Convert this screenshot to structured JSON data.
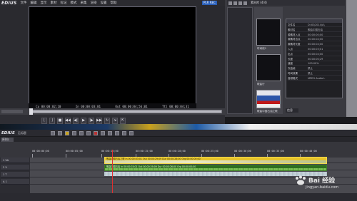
{
  "app": {
    "name": "EDIUS",
    "mode_badge": "PLR REC"
  },
  "menu": [
    "文件",
    "编辑",
    "显示",
    "素材",
    "标记",
    "模式",
    "采集",
    "渲染",
    "设置",
    "帮助"
  ],
  "player": {
    "cue": "Cu 00:00:02;10",
    "in": "In 00:00:03;01",
    "out": "Out 00:00:04;56;01",
    "dur": "Ttl 00:00:04;31"
  },
  "bin": {
    "title": "素材库 (4/4)",
    "thumbs": [
      {
        "label": "时间线1"
      },
      {
        "label": "歌曲行"
      },
      {
        "label": "歌曲中国石油之歌"
      }
    ]
  },
  "properties": {
    "rows": [
      {
        "k": "文件名",
        "v": "D:\\ID\\2014\\A\\"
      },
      {
        "k": "素材名",
        "v": "歌曲中国石油"
      },
      {
        "k": "源素材入点",
        "v": "00:00:00;00"
      },
      {
        "k": "源素材出点",
        "v": "00:00:04;00"
      },
      {
        "k": "源素材长度",
        "v": "00:00:04;00"
      },
      {
        "k": "入点",
        "v": "00:00:03;01"
      },
      {
        "k": "出点",
        "v": "00:00:04;00"
      },
      {
        "k": "长度",
        "v": "00:00:00;29"
      },
      {
        "k": "速度",
        "v": "100.00%"
      },
      {
        "k": "冻结帧",
        "v": "禁止"
      },
      {
        "k": "时间效果",
        "v": "禁止"
      },
      {
        "k": "音频格式",
        "v": "MPEG Audio L"
      }
    ]
  },
  "info_tag": "信息",
  "timeline": {
    "project": "无标题",
    "sequence_tab": "序列1",
    "ruler": [
      "00:00:00;00",
      "00:00:05;00",
      "00:00:10;00",
      "00:00:15;00",
      "00:00:20;00",
      "00:00:25;00",
      "00:00:30;00",
      "00:00:35;00",
      "00:00:40;00"
    ],
    "tracks": [
      "1 VA",
      "2 V",
      "1 T",
      "A 1"
    ],
    "clip_video": "歌曲中国石油之歌    In 00:00:03;01  Out 00:00:29;09  Dur 00:00:26;00   Org 00:00:00;00",
    "clip_audio": "歌曲中国石油  In 00:00:03;01  Out 00:00:29;09  Dur 00:00:26;00   Org 00:00:00;00"
  },
  "watermark": {
    "text": "Bai 经验",
    "url": "jingyan.baidu.com"
  }
}
